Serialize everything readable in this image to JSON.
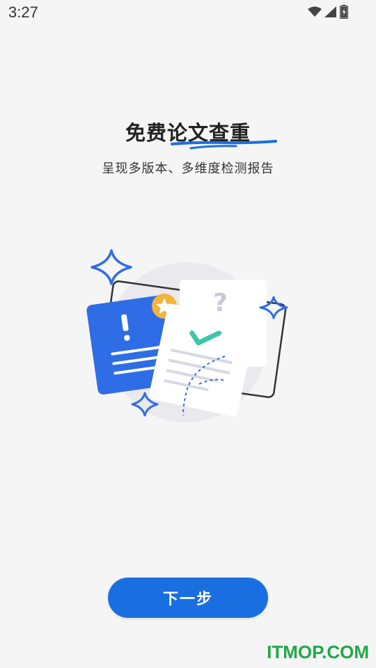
{
  "status_bar": {
    "time": "3:27",
    "icons": [
      "wifi-icon",
      "cellular-signal-icon",
      "battery-charging-icon"
    ]
  },
  "onboarding": {
    "title": "免费论文查重",
    "subtitle": "呈现多版本、多维度检测报告",
    "illustration": "report-documents-illustration",
    "next_button_label": "下一步"
  },
  "watermark": {
    "text": "ITMOP.COM"
  },
  "colors": {
    "background": "#f5f5f5",
    "accent": "#1a6fe0",
    "check": "#3ec6a8",
    "star_badge": "#f3b43a",
    "watermark": "#21a84a"
  }
}
